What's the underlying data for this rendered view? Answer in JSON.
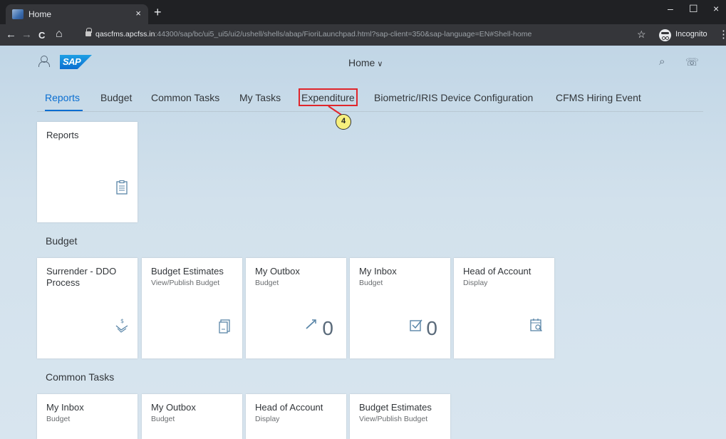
{
  "browser": {
    "tab_title": "Home",
    "tab_close": "×",
    "new_tab": "+",
    "window_controls": {
      "minimize": "–",
      "maximize": "☐",
      "close": "×"
    },
    "nav": {
      "back": "←",
      "forward": "→",
      "reload": "C",
      "home": "⌂"
    },
    "url_host": "qascfms.apcfss.in",
    "url_rest": ":44300/sap/bc/ui5_ui5/ui2/ushell/shells/abap/FioriLaunchpad.html?sap-client=350&sap-language=EN#Shell-home",
    "star": "☆",
    "incognito_label": "Incognito",
    "menu": "⋮"
  },
  "shell": {
    "title": "Home",
    "title_chevron": "∨",
    "logo_text": "SAP",
    "search_icon": "⌕",
    "notifications_icon": "☏"
  },
  "anchors": [
    "Reports",
    "Budget",
    "Common Tasks",
    "My Tasks",
    "Expenditure",
    "Biometric/IRIS Device Configuration",
    "CFMS Hiring Event"
  ],
  "callout_number": "4",
  "groups": {
    "reports": {
      "tiles": [
        {
          "title": "Reports",
          "subtitle": "",
          "icon": "clipboard-icon"
        }
      ]
    },
    "budget": {
      "title": "Budget",
      "tiles": [
        {
          "title": "Surrender - DDO Process",
          "subtitle": "",
          "icon": "money-hand-icon"
        },
        {
          "title": "Budget Estimates",
          "subtitle": "View/Publish Budget",
          "icon": "document-icon"
        },
        {
          "title": "My Outbox",
          "subtitle": "Budget",
          "icon": "paper-plane-icon",
          "number": "0"
        },
        {
          "title": "My Inbox",
          "subtitle": "Budget",
          "icon": "checkbox-icon",
          "number": "0"
        },
        {
          "title": "Head of Account",
          "subtitle": "Display",
          "icon": "calendar-search-icon"
        }
      ]
    },
    "common": {
      "title": "Common Tasks",
      "tiles": [
        {
          "title": "My Inbox",
          "subtitle": "Budget"
        },
        {
          "title": "My Outbox",
          "subtitle": "Budget"
        },
        {
          "title": "Head of Account",
          "subtitle": "Display"
        },
        {
          "title": "Budget Estimates",
          "subtitle": "View/Publish Budget"
        }
      ]
    }
  }
}
